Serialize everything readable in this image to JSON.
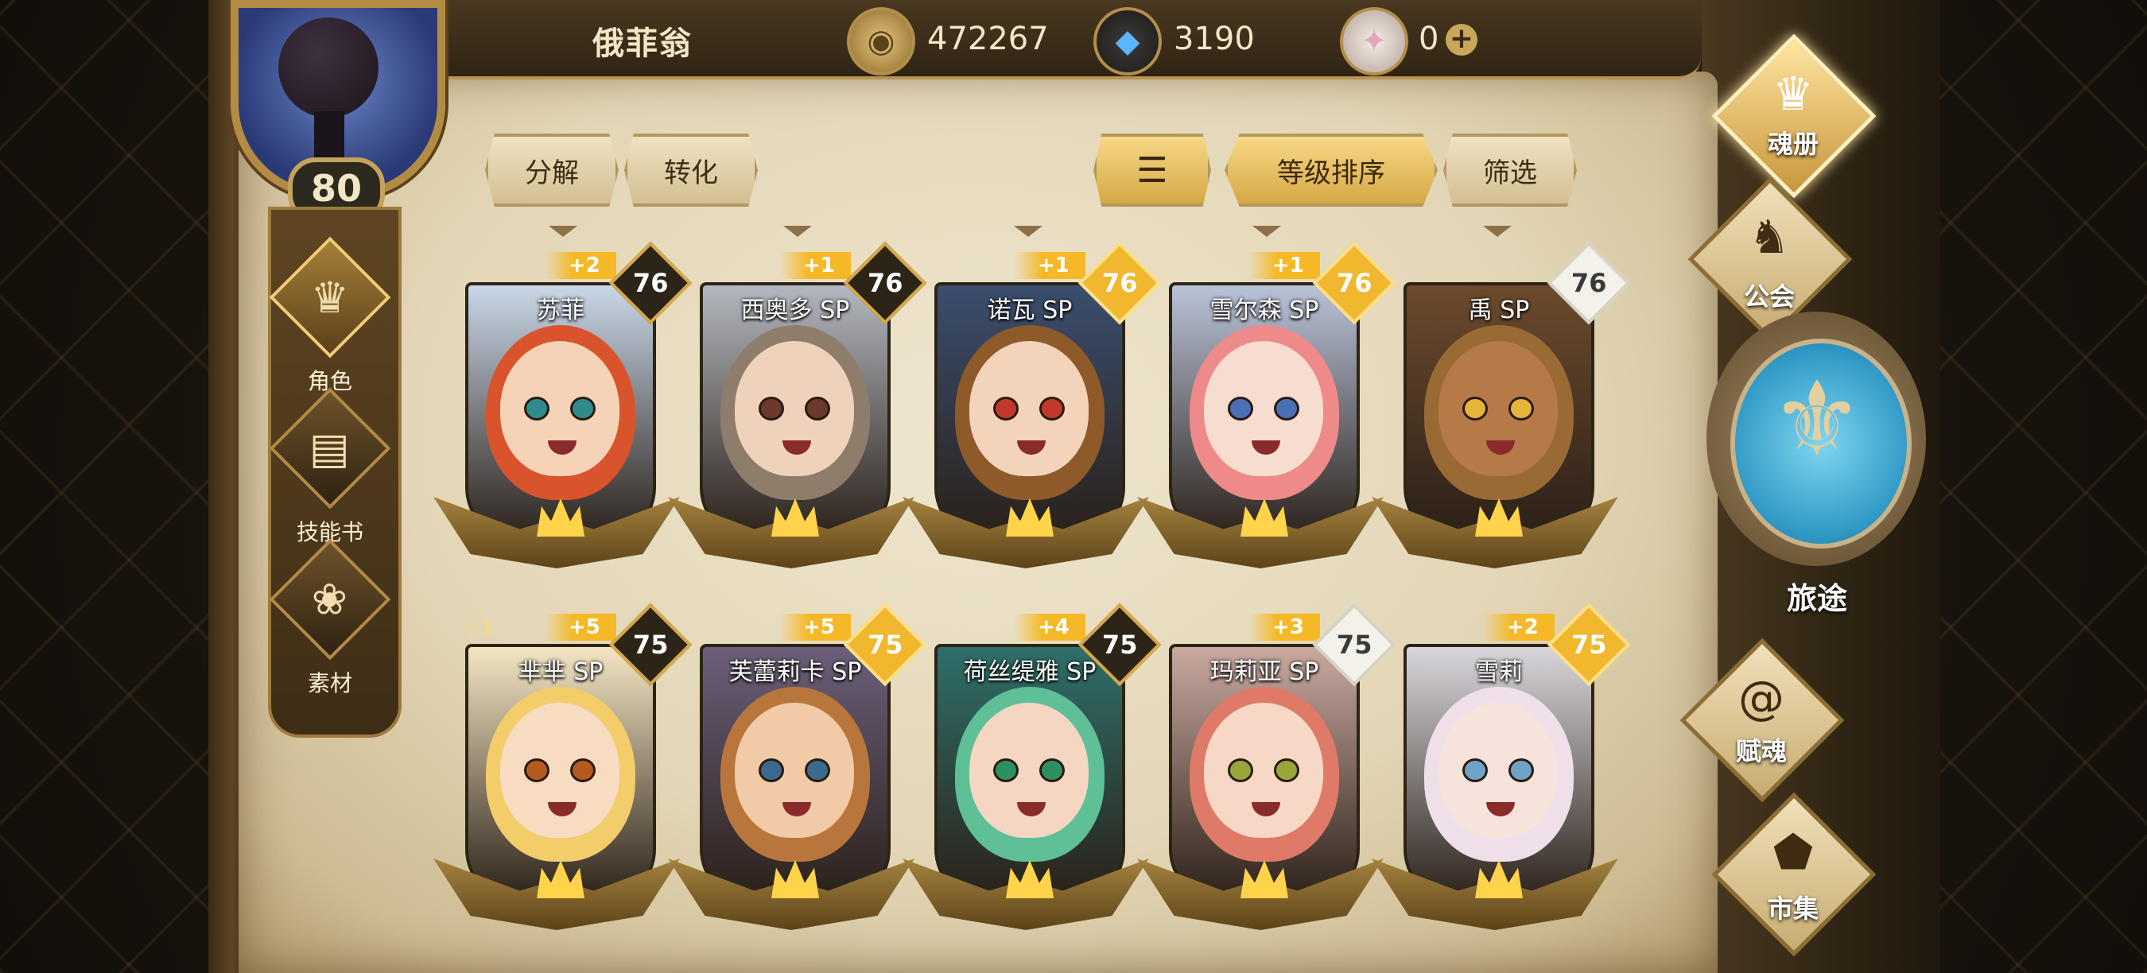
{
  "player": {
    "name": "俄菲翁",
    "level": "80"
  },
  "resources": [
    {
      "icon": "coin-icon",
      "value": "472267"
    },
    {
      "icon": "crystal-icon",
      "value": "3190"
    },
    {
      "icon": "gem-icon",
      "value": "0"
    }
  ],
  "left_nav": [
    {
      "label": "角色",
      "icon": "helmet-icon",
      "active": true
    },
    {
      "label": "技能书",
      "icon": "book-icon",
      "active": false
    },
    {
      "label": "素材",
      "icon": "creature-icon",
      "active": false
    }
  ],
  "actions": {
    "decompose": "分解",
    "convert": "转化",
    "sort_level": "等级排序",
    "filter": "筛选"
  },
  "cards": [
    {
      "name": "苏菲",
      "level": "76",
      "plus": "+2",
      "lvl_style": "dark",
      "bg": "#c9d7e8",
      "hair": "#d9542c",
      "skin": "#f6d2b7",
      "eye": "#2f8a8a"
    },
    {
      "name": "西奥多 SP",
      "level": "76",
      "plus": "+1",
      "lvl_style": "dark",
      "bg": "#b3b7bf",
      "hair": "#8f7d6b",
      "skin": "#eed2bc",
      "eye": "#6b3a2c"
    },
    {
      "name": "诺瓦 SP",
      "level": "76",
      "plus": "+1",
      "lvl_style": "gold",
      "bg": "#3b4e6f",
      "hair": "#8e5a2a",
      "skin": "#f4d3bb",
      "eye": "#c0392b"
    },
    {
      "name": "雪尔森 SP",
      "level": "76",
      "plus": "+1",
      "lvl_style": "gold",
      "bg": "#b9c3d8",
      "hair": "#ee8a8a",
      "skin": "#f7dcd0",
      "eye": "#4a6fb6"
    },
    {
      "name": "禹 SP",
      "level": "76",
      "plus": "",
      "lvl_style": "white",
      "bg": "#6c4a2d",
      "hair": "#9a6a35",
      "skin": "#b57a48",
      "eye": "#e6b43b"
    },
    {
      "name": "芈芈 SP",
      "level": "75",
      "plus": "+5",
      "lvl_style": "dark",
      "bg": "#f4e6c3",
      "hair": "#f3cd6a",
      "skin": "#f8dcc2",
      "eye": "#b55a1e",
      "extra": "◇1"
    },
    {
      "name": "芙蕾莉卡 SP",
      "level": "75",
      "plus": "+5",
      "lvl_style": "gold",
      "bg": "#6b5f7a",
      "hair": "#b9763c",
      "skin": "#f1caa7",
      "eye": "#3c6a8f"
    },
    {
      "name": "荷丝缇雅 SP",
      "level": "75",
      "plus": "+4",
      "lvl_style": "dark",
      "bg": "#2f6f6a",
      "hair": "#5fbf97",
      "skin": "#f4d6c2",
      "eye": "#2e8f5f"
    },
    {
      "name": "玛莉亚 SP",
      "level": "75",
      "plus": "+3",
      "lvl_style": "white",
      "bg": "#c9a9a0",
      "hair": "#e07a68",
      "skin": "#f7d8c6",
      "eye": "#9aa63b"
    },
    {
      "name": "雪莉",
      "level": "75",
      "plus": "+2",
      "lvl_style": "gold",
      "bg": "#d9d6dc",
      "hair": "#efdfe8",
      "skin": "#f6e3dc",
      "eye": "#6fa3c8"
    }
  ],
  "right_nav": [
    {
      "label": "魂册",
      "icon": "helmet-icon",
      "active": true
    },
    {
      "label": "公会",
      "icon": "dragon-icon",
      "active": false
    },
    {
      "label": "旅途",
      "icon": "emblem-icon",
      "active": false
    },
    {
      "label": "赋魂",
      "icon": "swirl-icon",
      "active": false
    },
    {
      "label": "市集",
      "icon": "pentagon-icon",
      "active": false
    }
  ]
}
